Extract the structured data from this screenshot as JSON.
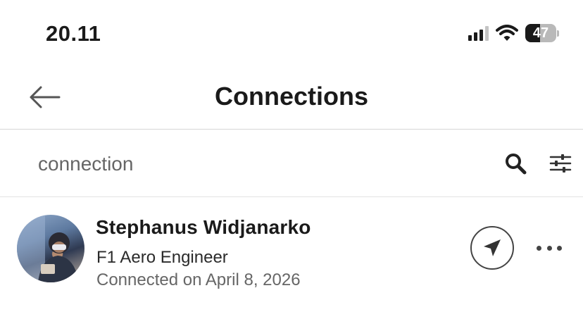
{
  "status_bar": {
    "time": "20.11",
    "battery_level": "47",
    "icons": [
      "signal-icon",
      "wifi-icon",
      "battery-icon"
    ]
  },
  "header": {
    "title": "Connections",
    "back_icon": "arrow-left-icon"
  },
  "search": {
    "placeholder": "connection",
    "search_icon": "search-icon",
    "filter_icon": "filter-sliders-icon"
  },
  "connections": [
    {
      "name": "Stephanus Widjanarko",
      "headline": "F1 Aero Engineer",
      "connected_on": "Connected on April 8, 2026",
      "message_icon": "send-icon",
      "more_icon": "more-horizontal-icon"
    }
  ],
  "colors": {
    "text_primary": "#1a1a1a",
    "text_secondary": "#666666",
    "divider": "#d6d6d6",
    "icon": "#444444"
  }
}
